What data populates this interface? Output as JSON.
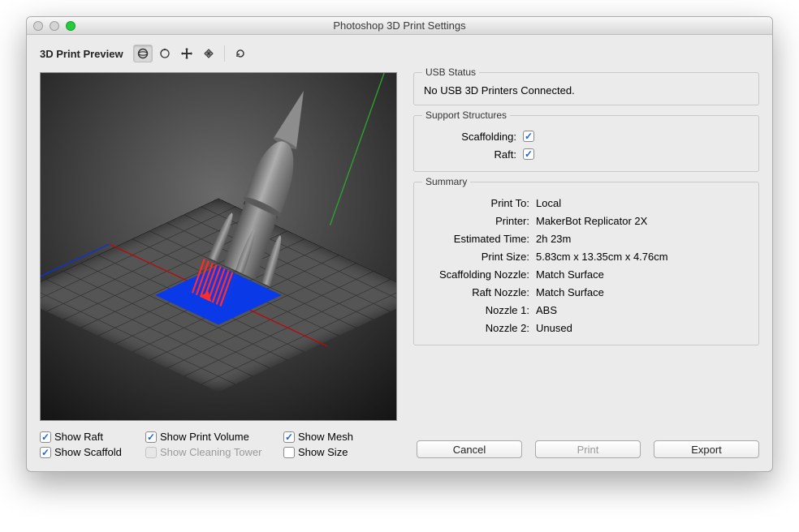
{
  "window": {
    "title": "Photoshop 3D Print Settings"
  },
  "toolbar": {
    "label": "3D Print Preview"
  },
  "left_checks": {
    "show_raft": "Show Raft",
    "show_print_volume": "Show Print Volume",
    "show_mesh": "Show Mesh",
    "show_scaffold": "Show Scaffold",
    "show_cleaning_tower": "Show Cleaning Tower",
    "show_size": "Show Size"
  },
  "groups": {
    "usb_title": "USB Status",
    "usb_message": "No USB 3D Printers Connected.",
    "support_title": "Support Structures",
    "scaffolding_label": "Scaffolding:",
    "raft_label": "Raft:",
    "summary_title": "Summary"
  },
  "summary": {
    "print_to_label": "Print To:",
    "print_to_value": "Local",
    "printer_label": "Printer:",
    "printer_value": "MakerBot Replicator 2X",
    "time_label": "Estimated Time:",
    "time_value": "2h 23m",
    "size_label": "Print Size:",
    "size_value": "5.83cm x 13.35cm x 4.76cm",
    "scaffold_nozzle_label": "Scaffolding Nozzle:",
    "scaffold_nozzle_value": "Match Surface",
    "raft_nozzle_label": "Raft Nozzle:",
    "raft_nozzle_value": "Match Surface",
    "nozzle1_label": "Nozzle 1:",
    "nozzle1_value": "ABS",
    "nozzle2_label": "Nozzle 2:",
    "nozzle2_value": "Unused"
  },
  "buttons": {
    "cancel": "Cancel",
    "print": "Print",
    "export": "Export"
  }
}
